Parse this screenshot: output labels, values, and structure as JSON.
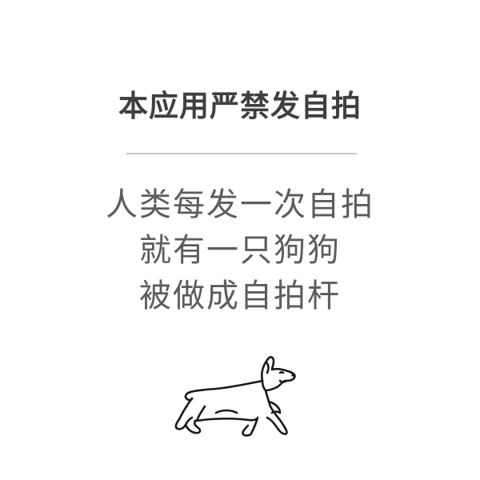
{
  "screen": {
    "title": "本应用严禁发自拍",
    "message_lines": [
      "人类每发一次自拍",
      "就有一只狗狗",
      "被做成自拍杆"
    ],
    "illustration": {
      "icon": "corgi-dog-icon",
      "stroke_color": "#1a1a1a"
    },
    "colors": {
      "background": "#ffffff",
      "title": "#3f3f3f",
      "message": "#5c5c5c",
      "divider": "#c4c4c4"
    }
  }
}
